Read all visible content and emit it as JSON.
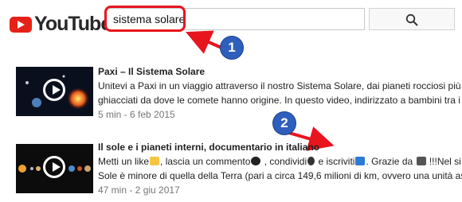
{
  "header": {
    "logo_text": "YouTube",
    "search": {
      "value": "sistema solare"
    }
  },
  "callouts": [
    "1",
    "2"
  ],
  "results": [
    {
      "title": "Paxi – Il Sistema Solare",
      "desc1": "Unitevi a Paxi in un viaggio attraverso il nostro Sistema Solare, dai pianeti rocciosi più in",
      "desc2": "ghiacciati da dove le comete hanno origine. In questo video, indirizzato a bambini tra i",
      "meta": "5 min - 6 feb 2015"
    },
    {
      "title": "Il sole e i pianeti interni, documentario in italiano",
      "desc1_parts": [
        "Metti un like",
        ", lascia un commento",
        " , condividi",
        " e iscriviti",
        ". Grazie da ",
        " !!!Nel si"
      ],
      "desc2": "Sole è minore di quella della Terra (pari a circa 149,6 milioni di km, ovvero una unità ast",
      "meta": "47 min - 2 giu 2017"
    }
  ],
  "colors": {
    "accent_red": "#e8141e",
    "callout_blue": "#2f5fbd",
    "yt_red": "#e62117"
  }
}
